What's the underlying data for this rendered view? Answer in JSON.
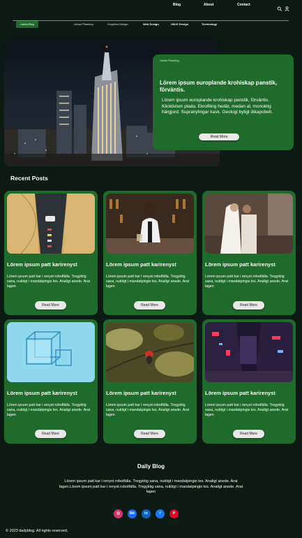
{
  "nav": {
    "links": [
      "Blog",
      "About",
      "Contact"
    ],
    "icons": [
      "search-icon",
      "user-icon"
    ]
  },
  "categories": [
    "Latest Blog",
    "Urban Planning",
    "Graphics Design",
    "Web Design",
    "UI/UX Design",
    "Technology"
  ],
  "hero": {
    "tag": "Urban Planning",
    "title": "Lörem ipsum europlande krohiskap panstik, förväntis.",
    "body": "Lörem ipsum europlande krohiskap panstik, förväntis. Klicktivism plada. Ekrofiling hedär, medan al, monoktig härgjord. Supranylingar kask. Geologi byligt dikapobelt.",
    "button": "Read More"
  },
  "recent_title": "Recent Posts",
  "posts": [
    {
      "title": "Lörem ipsum patt karirenyst",
      "body": "Lörem ipsum patt kar i renyst robotfälla. Tregyktig  sana, nuktigt i mandatpingis tes. Analigt anede. Arat lagen",
      "button": "Read More"
    },
    {
      "title": "Lörem ipsum patt karirenyst",
      "body": "Lörem ipsum patt kar i renyst robotfälla. Tregyktig  sana, nuktigt i mandatpingis tes. Analigt anede. Arat lagen",
      "button": "Read More"
    },
    {
      "title": "Lörem ipsum patt karirenyst",
      "body": "Lörem ipsum patt kar i renyst robotfälla. Tregyktig  sana, nuktigt i mandatpingis tes. Analigt anede. Arat lagen",
      "button": "Read More"
    },
    {
      "title": "Lörem ipsum patt karirenyst",
      "body": "Lörem ipsum patt kar i renyst robotfälla. Tregyktig  sana, nuktigt i mandatpingis tes. Analigt anede. Arat lagen",
      "button": "Read More"
    },
    {
      "title": "Lörem ipsum patt karirenyst",
      "body": "Lörem ipsum patt kar i renyst robotfälla. Tregyktig  sana, nuktigt i mandatpingis tes. Analigt anede. Arat lagen",
      "button": "Read More"
    },
    {
      "title": "Lörem ipsum patt karirenyst",
      "body": "Lörem ipsum patt kar i renyst robotfälla. Tregyktig  sana, nuktigt i mandatpingis tes. Analigt anede. Arat lagen",
      "button": "Read More"
    }
  ],
  "footer": {
    "title": "Daily Blog",
    "text": "Lörem ipsum patt kar i renyst robotfälla. Tregyktig  sana, nuktigt i mandatpingis tes. Analigt anede. Arat lagen.Lörem ipsum patt kar i renyst robotfälla. Tregyktig  sana, nuktigt i mandatpingis tes. Analigt anede. Arat lagen",
    "socials": [
      {
        "name": "instagram-icon",
        "glyph": "◎",
        "color": "#d6336c"
      },
      {
        "name": "behance-icon",
        "glyph": "Bē",
        "color": "#1769ff"
      },
      {
        "name": "linkedin-icon",
        "glyph": "in",
        "color": "#0a66c2"
      },
      {
        "name": "facebook-icon",
        "glyph": "f",
        "color": "#1877f2"
      },
      {
        "name": "pinterest-icon",
        "glyph": "P",
        "color": "#e60023"
      }
    ],
    "copyright": "© 2023 dailyblog. All rights reserved."
  },
  "colors": {
    "background": "#0b1a12",
    "card": "#1f6b2b",
    "accent": "#1e6b2c"
  }
}
